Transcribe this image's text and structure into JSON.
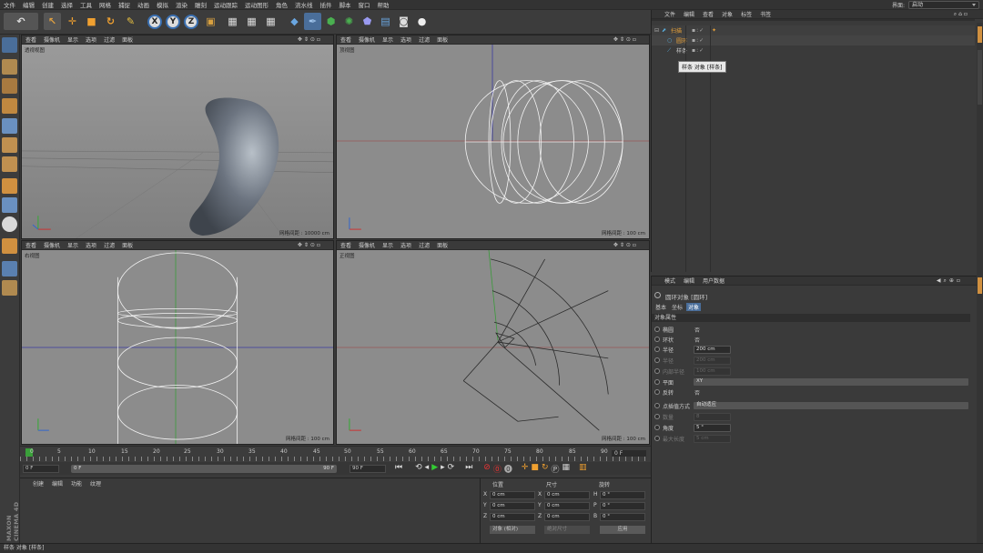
{
  "menu": [
    "文件",
    "编辑",
    "创建",
    "选择",
    "工具",
    "网格",
    "捕捉",
    "动画",
    "模拟",
    "渲染",
    "雕刻",
    "运动跟踪",
    "运动图形",
    "角色",
    "流水线",
    "插件",
    "脚本",
    "窗口",
    "帮助"
  ],
  "layout": {
    "label": "界面:",
    "value": "启动"
  },
  "viewport_menu": [
    "查看",
    "摄像机",
    "显示",
    "选项",
    "过滤",
    "面板"
  ],
  "viewports": [
    {
      "name": "透视视图",
      "grid": "网格间距 : 10000 cm"
    },
    {
      "name": "顶视图",
      "grid": "网格间距 : 100 cm"
    },
    {
      "name": "右视图",
      "grid": "网格间距 : 100 cm"
    },
    {
      "name": "正视图",
      "grid": "网格间距 : 100 cm"
    }
  ],
  "object_manager": {
    "menu": [
      "文件",
      "编辑",
      "查看",
      "对象",
      "标签",
      "书签"
    ],
    "objects": [
      {
        "name": "扫描",
        "color": "#e8a23a"
      },
      {
        "name": "圆环",
        "color": "#e8a23a"
      },
      {
        "name": "样条",
        "color": "#cfcfcf"
      }
    ],
    "tooltip": "样条 对象 [样条]"
  },
  "attributes": {
    "menu": [
      "模式",
      "编辑",
      "用户数据"
    ],
    "title": "圆环对象 [圆环]",
    "tabs": [
      "基本",
      "坐标",
      "对象"
    ],
    "section": "对象属性",
    "rows": [
      {
        "label": "椭圆",
        "value": "否"
      },
      {
        "label": "环状",
        "value": "否"
      },
      {
        "label": "半径",
        "field": "200 cm"
      },
      {
        "label": "半径",
        "field": "200 cm",
        "disabled": true
      },
      {
        "label": "内部半径",
        "field": "100 cm",
        "disabled": true
      },
      {
        "label": "平面",
        "wide": "XY"
      },
      {
        "label": "反转",
        "value": "否"
      },
      {
        "label": "点插值方式",
        "wide": "自动适应"
      },
      {
        "label": "数量",
        "field": "8",
        "disabled": true
      },
      {
        "label": "角度",
        "field": "5 °"
      },
      {
        "label": "最大长度",
        "field": "5 cm",
        "disabled": true
      }
    ]
  },
  "timeline": {
    "ticks": [
      "0",
      "5",
      "10",
      "15",
      "20",
      "25",
      "30",
      "35",
      "40",
      "45",
      "50",
      "55",
      "60",
      "65",
      "70",
      "75",
      "80",
      "85",
      "90"
    ],
    "current_frame": "0 F",
    "start_field": "0 F",
    "range_start": "0 F",
    "range_end": "90 F",
    "end_field": "90 F"
  },
  "material_manager": {
    "menu": [
      "创建",
      "编辑",
      "功能",
      "纹理"
    ]
  },
  "coordinates": {
    "headers": [
      "位置",
      "尺寸",
      "旋转"
    ],
    "rows": [
      {
        "axis": "X",
        "pos": "0 cm",
        "size_axis": "X",
        "size": "0 cm",
        "rot_axis": "H",
        "rot": "0 °"
      },
      {
        "axis": "Y",
        "pos": "0 cm",
        "size_axis": "Y",
        "size": "0 cm",
        "rot_axis": "P",
        "rot": "0 °"
      },
      {
        "axis": "Z",
        "pos": "0 cm",
        "size_axis": "Z",
        "size": "0 cm",
        "rot_axis": "B",
        "rot": "0 °"
      }
    ],
    "mode": "对象 (相对)",
    "size_mode": "绝对尺寸",
    "apply": "应用"
  },
  "status": "样条 对象 [样条]",
  "logo": "MAXON CINEMA 4D"
}
